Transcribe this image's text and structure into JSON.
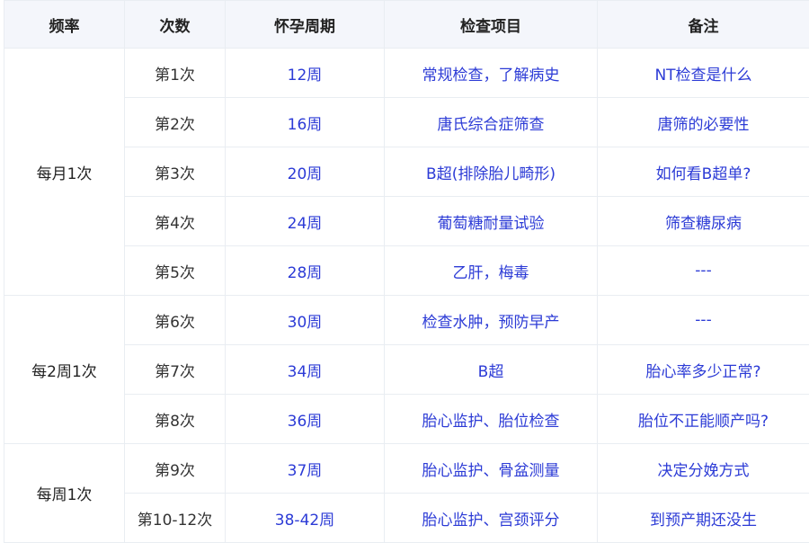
{
  "headers": {
    "frequency": "频率",
    "count": "次数",
    "week": "怀孕周期",
    "item": "检查项目",
    "note": "备注"
  },
  "groups": [
    {
      "frequency": "每月1次",
      "rows": [
        {
          "count": "第1次",
          "week": "12周",
          "item": "常规检查，了解病史",
          "note": "NT检查是什么"
        },
        {
          "count": "第2次",
          "week": "16周",
          "item": "唐氏综合症筛查",
          "note": "唐筛的必要性"
        },
        {
          "count": "第3次",
          "week": "20周",
          "item": "B超(排除胎儿畸形)",
          "note": "如何看B超单?"
        },
        {
          "count": "第4次",
          "week": "24周",
          "item": "葡萄糖耐量试验",
          "note": "筛查糖尿病"
        },
        {
          "count": "第5次",
          "week": "28周",
          "item": "乙肝，梅毒",
          "note": "---"
        }
      ]
    },
    {
      "frequency": "每2周1次",
      "rows": [
        {
          "count": "第6次",
          "week": "30周",
          "item": "检查水肿，预防早产",
          "note": "---"
        },
        {
          "count": "第7次",
          "week": "34周",
          "item": "B超",
          "note": "胎心率多少正常?"
        },
        {
          "count": "第8次",
          "week": "36周",
          "item": "胎心监护、胎位检查",
          "note": "胎位不正能顺产吗?"
        }
      ]
    },
    {
      "frequency": "每周1次",
      "rows": [
        {
          "count": "第9次",
          "week": "37周",
          "item": "胎心监护、骨盆测量",
          "note": "决定分娩方式"
        },
        {
          "count": "第10-12次",
          "week": "38-42周",
          "item": "胎心监护、宫颈评分",
          "note": "到预产期还没生"
        }
      ]
    }
  ],
  "colors": {
    "header_bg": "#f4f6fb",
    "frequency_bg": "#fff6fc",
    "link_text": "#2c3bd6",
    "border": "#e9edf2"
  }
}
